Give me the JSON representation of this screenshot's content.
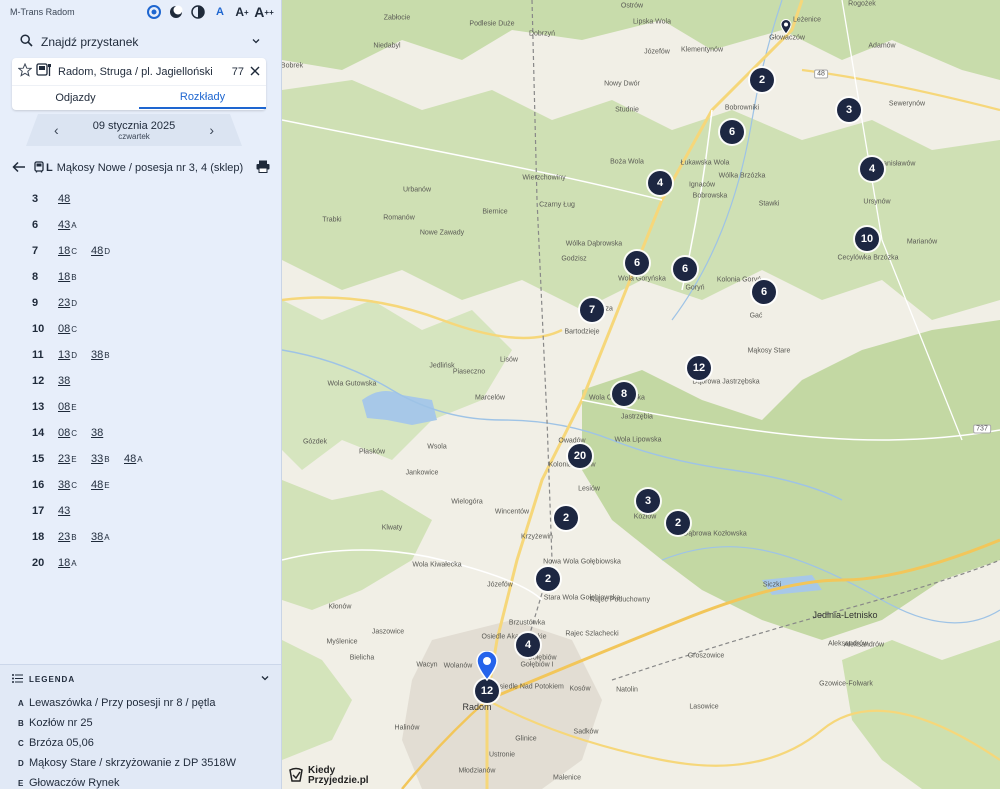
{
  "app": {
    "name": "M-Trans Radom"
  },
  "toolbar": {
    "text_size_small": "A",
    "text_size_medium": "A",
    "text_size_large": "A"
  },
  "search": {
    "placeholder": "Znajdź przystanek"
  },
  "stop": {
    "name": "Radom, Struga / pl. Jagielloński",
    "number": "77"
  },
  "tabs": [
    {
      "label": "Odjazdy",
      "active": false
    },
    {
      "label": "Rozkłady",
      "active": true
    }
  ],
  "date": {
    "main": "09 stycznia 2025",
    "weekday": "czwartek"
  },
  "route": {
    "line": "L",
    "name": "Mąkosy Nowe / posesja nr 3, 4 (sklep)"
  },
  "timetable": [
    {
      "hour": "3",
      "minutes": [
        {
          "m": "48",
          "s": ""
        }
      ]
    },
    {
      "hour": "6",
      "minutes": [
        {
          "m": "43",
          "s": "A"
        }
      ]
    },
    {
      "hour": "7",
      "minutes": [
        {
          "m": "18",
          "s": "C"
        },
        {
          "m": "48",
          "s": "D"
        }
      ]
    },
    {
      "hour": "8",
      "minutes": [
        {
          "m": "18",
          "s": "B"
        }
      ]
    },
    {
      "hour": "9",
      "minutes": [
        {
          "m": "23",
          "s": "D"
        }
      ]
    },
    {
      "hour": "10",
      "minutes": [
        {
          "m": "08",
          "s": "C"
        }
      ]
    },
    {
      "hour": "11",
      "minutes": [
        {
          "m": "13",
          "s": "D"
        },
        {
          "m": "38",
          "s": "B"
        }
      ]
    },
    {
      "hour": "12",
      "minutes": [
        {
          "m": "38",
          "s": ""
        }
      ]
    },
    {
      "hour": "13",
      "minutes": [
        {
          "m": "08",
          "s": "E"
        }
      ]
    },
    {
      "hour": "14",
      "minutes": [
        {
          "m": "08",
          "s": "C"
        },
        {
          "m": "38",
          "s": ""
        }
      ]
    },
    {
      "hour": "15",
      "minutes": [
        {
          "m": "23",
          "s": "E"
        },
        {
          "m": "33",
          "s": "B"
        },
        {
          "m": "48",
          "s": "A"
        }
      ]
    },
    {
      "hour": "16",
      "minutes": [
        {
          "m": "38",
          "s": "C"
        },
        {
          "m": "48",
          "s": "E"
        }
      ]
    },
    {
      "hour": "17",
      "minutes": [
        {
          "m": "43",
          "s": ""
        }
      ]
    },
    {
      "hour": "18",
      "minutes": [
        {
          "m": "23",
          "s": "B"
        },
        {
          "m": "38",
          "s": "A"
        }
      ]
    },
    {
      "hour": "20",
      "minutes": [
        {
          "m": "18",
          "s": "A"
        }
      ]
    }
  ],
  "legend": {
    "title": "LEGENDA",
    "items": [
      {
        "key": "A",
        "text": "Lewaszówka / Przy posesji nr 8 / pętla"
      },
      {
        "key": "B",
        "text": "Kozłów nr 25"
      },
      {
        "key": "C",
        "text": "Brzóza 05,06"
      },
      {
        "key": "D",
        "text": "Mąkosy Stare / skrzyżowanie z DP 3518W"
      },
      {
        "key": "E",
        "text": "Głowaczów Rynek"
      }
    ]
  },
  "map": {
    "brand": {
      "line1": "Kiedy",
      "line2": "Przyjedzie.pl"
    },
    "road_badges": [
      "48",
      "737"
    ],
    "clusters": [
      "2",
      "3",
      "6",
      "4",
      "4",
      "10",
      "6",
      "6",
      "6",
      "7",
      "12",
      "8",
      "20",
      "3",
      "2",
      "2",
      "2",
      "4",
      "12"
    ],
    "places": [
      "Rogożek",
      "Lipska Wola",
      "Podlesie Duże",
      "Dobrzyń",
      "Głowaczów",
      "Ostrów",
      "Zabłocie",
      "Bobrek",
      "Niedabyl",
      "Nowy Dwór",
      "Leżenice",
      "Adamów",
      "Sewerynów",
      "Bobrowniki",
      "Studnie",
      "Wola Owadowska",
      "Bartodzieje",
      "Brzóza",
      "Jedlnia-Letnisko",
      "Radom",
      "Wierzchowiny",
      "Jedlińsk",
      "Marianów",
      "Cecylówka Brzózka",
      "Ursynów",
      "Stanisławów",
      "Mąkosy Stare",
      "Dąbrowa Jastrzębska",
      "Jastrzębia",
      "Owadów",
      "Wola Lipowska",
      "Kolonia Lesiów",
      "Lesiów",
      "Kozłów",
      "Dąbrowa Kozłowska",
      "Nowa Wola Gołębiowska",
      "Stara Wola Gołębiowska",
      "Rajec Poduchowny",
      "Rajec Szlachecki",
      "Gołębiów I",
      "Osiedle Nad Potokiem",
      "Brzustówka",
      "Józefów",
      "Wolanów",
      "Sadków",
      "Glinice",
      "Kosów",
      "Natolin",
      "Lasowice",
      "Groszowice",
      "Gzowice-Folwark",
      "Aleksandrów",
      "Siczki",
      "Wielogóra",
      "Wincentów",
      "Krzyżewiń",
      "Wsola",
      "Gózdek",
      "Płasków",
      "Jankowice",
      "Wola Gutowska",
      "Piaseczno",
      "Lisów",
      "Marcelów",
      "Klwaty",
      "Wola Kiwałecka",
      "Kłonów",
      "Jaszowice",
      "Myślenice",
      "Bielicha",
      "Wacyn",
      "Halinów",
      "Ustronie",
      "Młodzianów",
      "Malenice",
      "Gołębiów",
      "Wola Goryńska",
      "Goryń",
      "Gać",
      "Kolonia Goryń",
      "Nowe Zawady",
      "Romanów",
      "Trabki",
      "Urbanów",
      "Biernice",
      "Czarny Ług",
      "Godzisz",
      "Wólka Dąbrowska",
      "Boża Wola",
      "Józefów",
      "Klementynów",
      "Brody",
      "Łukawska Wola",
      "Ignaców",
      "Bobrowska",
      "Wólka Brzózka",
      "Stawki",
      "Aleksandrów",
      "Osiedle Akademickie"
    ]
  },
  "colors": {
    "sidebar_bg": "#e7eefa",
    "accent": "#1e66d0",
    "cluster": "#1d2742",
    "forest": "#c8dcab",
    "water": "#a7c8e8"
  }
}
